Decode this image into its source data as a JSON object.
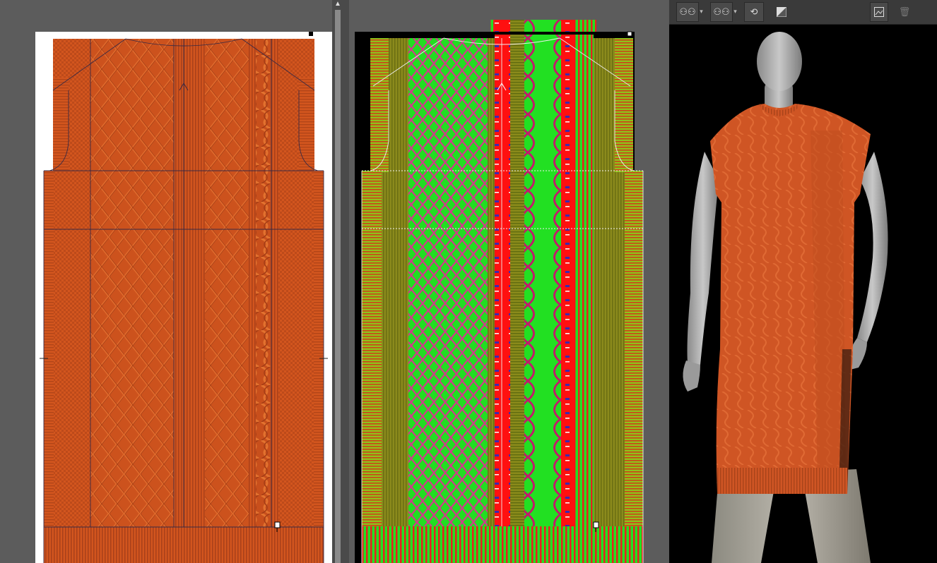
{
  "window": {
    "title": ""
  },
  "panes": [
    {
      "id": "knit-pattern-2d",
      "label": ""
    },
    {
      "id": "color-code-view",
      "label": ""
    },
    {
      "id": "3d-preview",
      "label": ""
    }
  ],
  "toolbar_3d": {
    "buttons": [
      {
        "id": "avatar-select",
        "icon": "mannequin-group-icon",
        "has_dropdown": true
      },
      {
        "id": "avatar-pose",
        "icon": "mannequin-pose-icon",
        "has_dropdown": true
      },
      {
        "id": "avatar-reset",
        "icon": "avatar-rotate-icon",
        "has_dropdown": false
      },
      {
        "id": "shading-toggle",
        "icon": "half-contrast-icon",
        "has_dropdown": false
      },
      {
        "id": "snapshot",
        "icon": "image-icon",
        "has_dropdown": false
      },
      {
        "id": "delete",
        "icon": "trash-icon",
        "has_dropdown": false
      }
    ]
  },
  "colors": {
    "knit_orange": "#d2551e",
    "knit_orange_dark": "#b8461a",
    "code_red": "#ff1010",
    "code_green": "#22e022",
    "code_olive": "#8a8a1a",
    "mannequin": "#b8b8b8",
    "pane_bg": "#5c5c5c",
    "toolbar_bg": "#3a3a3a"
  }
}
